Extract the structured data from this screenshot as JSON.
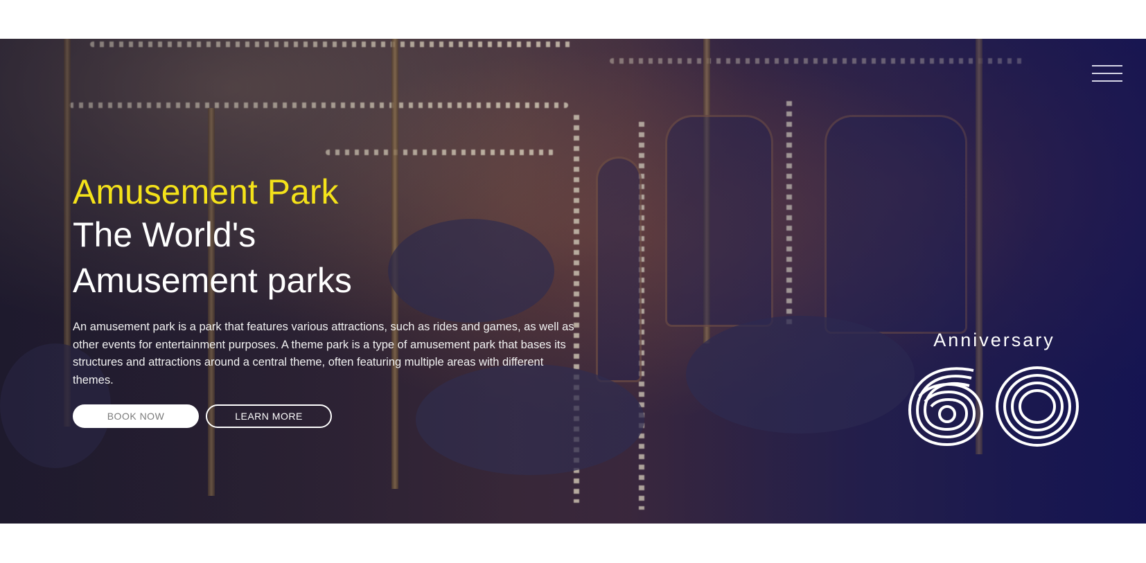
{
  "hero": {
    "title_line1": "Amusement Park",
    "title_line2": "The World's",
    "title_line3": "Amusement parks",
    "description": "An amusement park is a park that features various attractions, such as rides and games, as well as other events for entertainment purposes. A theme park is a type of amusement park that bases its structures and attractions around a central theme, often featuring multiple areas with different themes.",
    "buttons": {
      "book_label": "BOOK NOW",
      "learn_label": "LEARN MORE"
    }
  },
  "anniversary": {
    "label": "Anniversary",
    "number": "60"
  },
  "header": {
    "menu_icon": "hamburger-menu-icon"
  },
  "colors": {
    "accent_yellow": "#f4e21a",
    "text_white": "#ffffff",
    "overlay_blue": "#1c1a55"
  }
}
